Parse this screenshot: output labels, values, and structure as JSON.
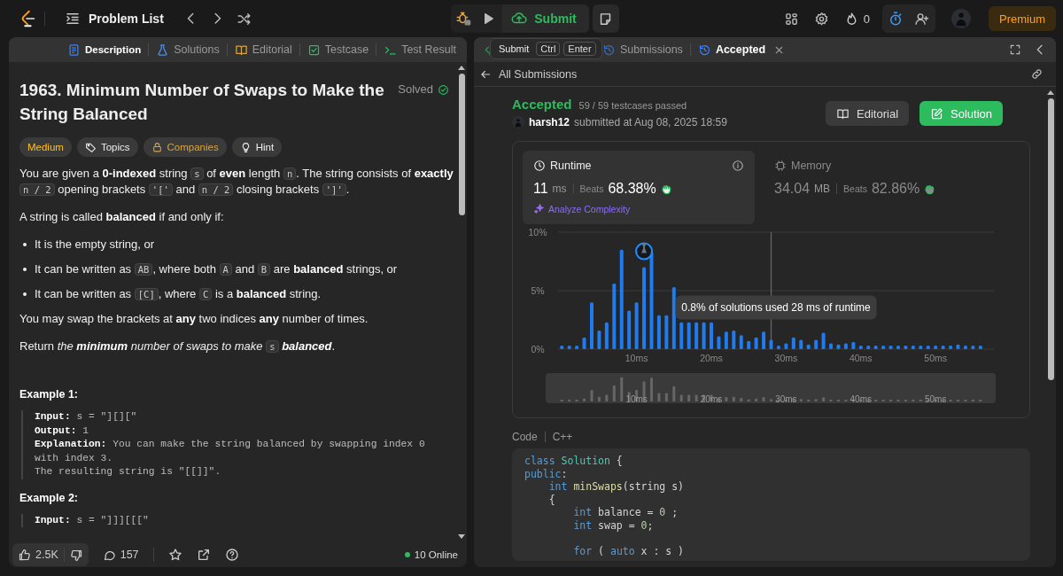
{
  "top_bar": {
    "problem_list": "Problem List",
    "submit": "Submit",
    "streak": "0",
    "premium": "Premium"
  },
  "submit_tooltip": {
    "label": "Submit",
    "keys": [
      "Ctrl",
      "Enter"
    ]
  },
  "problem_panel": {
    "tabs": [
      {
        "label": "Description",
        "kind": "description",
        "selected": true
      },
      {
        "label": "Solutions",
        "kind": "solutions",
        "selected": false
      },
      {
        "label": "Editorial",
        "kind": "editorial",
        "selected": false
      },
      {
        "label": "Testcase",
        "kind": "testcase",
        "selected": false
      },
      {
        "label": "Test Result",
        "kind": "result",
        "selected": false
      }
    ],
    "title": "1963. Minimum Number of Swaps to Make the String Balanced",
    "status": "Solved",
    "tags": [
      {
        "label": "Medium",
        "kind": "difficulty"
      },
      {
        "label": "Topics",
        "kind": "topics"
      },
      {
        "label": "Companies",
        "kind": "companies"
      },
      {
        "label": "Hint",
        "kind": "hint"
      }
    ],
    "body": [
      {
        "kind": "paragraph",
        "segments": [
          {
            "text": "You are given a **0-indexed** string "
          },
          {
            "text": "s",
            "kind": "code"
          },
          {
            "text": " of **even** length "
          },
          {
            "text": "n",
            "kind": "code"
          },
          {
            "text": ". The string consists of **exactly** "
          },
          {
            "text": "n / 2",
            "kind": "code"
          },
          {
            "text": " opening brackets "
          },
          {
            "text": "'['",
            "kind": "code"
          },
          {
            "text": " and "
          },
          {
            "text": "n / 2",
            "kind": "code"
          },
          {
            "text": " closing brackets "
          },
          {
            "text": "']'",
            "kind": "code"
          },
          {
            "text": "."
          }
        ]
      },
      {
        "kind": "paragraph",
        "segments": [
          {
            "text": "A string is called **balanced** if and only if:"
          }
        ]
      },
      {
        "kind": "bullet",
        "segments": [
          {
            "text": "It is the empty string, or"
          }
        ]
      },
      {
        "kind": "bullet",
        "segments": [
          {
            "text": "It can be written as "
          },
          {
            "text": "AB",
            "kind": "code"
          },
          {
            "text": ", where both "
          },
          {
            "text": "A",
            "kind": "code"
          },
          {
            "text": " and "
          },
          {
            "text": "B",
            "kind": "code"
          },
          {
            "text": " are **balanced** strings, or"
          }
        ]
      },
      {
        "kind": "bullet",
        "segments": [
          {
            "text": "It can be written as "
          },
          {
            "text": "[C]",
            "kind": "code"
          },
          {
            "text": ", where "
          },
          {
            "text": "C",
            "kind": "code"
          },
          {
            "text": " is a **balanced** string."
          }
        ]
      },
      {
        "kind": "paragraph",
        "segments": [
          {
            "text": "You may swap the brackets at **any** two indices **any** number of times."
          }
        ]
      },
      {
        "kind": "paragraph",
        "segments": [
          {
            "text": "Return "
          },
          {
            "text": "the **minimum** number of swaps to make ",
            "kind": "emphasis"
          },
          {
            "text": "s",
            "kind": "code"
          },
          {
            "text": " **balanced**",
            "kind": "emphasis"
          },
          {
            "text": "."
          }
        ]
      }
    ],
    "examples": [
      {
        "title": "Example 1:",
        "lines": [
          {
            "label": "Input:",
            "text": " s = \"][][\""
          },
          {
            "label": "Output:",
            "text": " 1"
          },
          {
            "label": "Explanation:",
            "text": " You can make the string balanced by swapping index 0 with index 3."
          },
          {
            "text": "The resulting string is \"[[]]\"."
          }
        ]
      },
      {
        "title": "Example 2:",
        "lines": [
          {
            "label": "Input:",
            "text": " s = \"]]][[[\""
          }
        ]
      }
    ],
    "footer": {
      "likes": "2.5K",
      "comments": "157",
      "online": "10 Online"
    }
  },
  "result_panel": {
    "tabs": [
      {
        "kind": "code",
        "selected": false
      },
      {
        "kind": "submissions",
        "label": "Submissions",
        "selected": false
      },
      {
        "kind": "accepted",
        "label": "Accepted",
        "selected": true
      }
    ],
    "back_link": "All Submissions",
    "result": {
      "status": "Accepted",
      "testcases": "59 / 59 testcases passed",
      "user": "harsh12",
      "submitted": "submitted at Aug 08, 2025 18:59",
      "buttons": [
        {
          "label": "Editorial",
          "kind": "secondary"
        },
        {
          "label": "Solution",
          "kind": "primary"
        }
      ]
    },
    "metrics": [
      {
        "kind": "runtime",
        "label": "Runtime",
        "value": "11",
        "unit": "ms",
        "beats_label": "Beats",
        "beats": "68.38%",
        "selected": true,
        "link": "Analyze Complexity"
      },
      {
        "kind": "memory",
        "label": "Memory",
        "value": "34.04",
        "unit": "MB",
        "beats_label": "Beats",
        "beats": "82.86%",
        "selected": false
      }
    ],
    "chart_data": {
      "type": "bar",
      "x": [
        0,
        1,
        2,
        3,
        4,
        5,
        6,
        7,
        8,
        9,
        10,
        11,
        12,
        13,
        14,
        15,
        16,
        17,
        18,
        19,
        20,
        21,
        22,
        23,
        24,
        25,
        26,
        27,
        28,
        29,
        30,
        31,
        32,
        33,
        34,
        35,
        36,
        37,
        38,
        39,
        40,
        41,
        42,
        43,
        44,
        45,
        46,
        47,
        48,
        49,
        50,
        51,
        52,
        53,
        54,
        55,
        56
      ],
      "xlim": [
        -0.5,
        57.8
      ],
      "series": [
        {
          "color": "#1f7cf0",
          "values": [
            0.3,
            0.3,
            0.3,
            1.0,
            4.0,
            1.6,
            2.3,
            5.6,
            8.5,
            3.3,
            4.0,
            7.0,
            8.3,
            2.9,
            2.9,
            5.3,
            2.3,
            2.3,
            2.3,
            2.3,
            2.3,
            1.1,
            1.5,
            1.6,
            1.2,
            0.7,
            1.0,
            1.5,
            0.8,
            0.3,
            0.5,
            1.0,
            0.8,
            0.4,
            0.8,
            1.4,
            0.5,
            0.4,
            0.5,
            0.6,
            0.3,
            0.3,
            0.3,
            0.3,
            0.3,
            0.3,
            0.3,
            0.3,
            0.3,
            0.3,
            0.3,
            0.3,
            0.3,
            0.4,
            0.3,
            0.3,
            0.3
          ]
        }
      ],
      "ylim": [
        0,
        10
      ],
      "yticks": [
        {
          "value": 0,
          "label": "0%"
        },
        {
          "value": 5,
          "label": "5%"
        },
        {
          "value": 10,
          "label": "10%"
        }
      ],
      "xticks": [
        {
          "value": 10,
          "label": "10ms"
        },
        {
          "value": 20,
          "label": "20ms"
        },
        {
          "value": 30,
          "label": "30ms"
        },
        {
          "value": 40,
          "label": "40ms"
        },
        {
          "value": 50,
          "label": "50ms"
        }
      ],
      "ref_lines": [
        {
          "axis": "x",
          "value": 28
        }
      ],
      "annotations": [
        {
          "x": 28,
          "y": 0.8,
          "text": "0.8% of solutions used 28 ms of runtime"
        }
      ]
    },
    "navigator_ticks": [
      "10ms",
      "20ms",
      "30ms",
      "40ms",
      "50ms"
    ],
    "code": {
      "label": "Code",
      "language": "C++",
      "lines": [
        {
          "segments": [
            {
              "text": "class",
              "kind": "keyword"
            },
            {
              "text": " Solution",
              "kind": "type"
            },
            {
              "text": " {"
            }
          ]
        },
        {
          "segments": [
            {
              "text": "public",
              "kind": "keyword"
            },
            {
              "text": ":"
            }
          ]
        },
        {
          "segments": [
            {
              "text": "    int",
              "kind": "keyword"
            },
            {
              "text": " minSwaps",
              "kind": "function"
            },
            {
              "text": "(string s)"
            }
          ]
        },
        {
          "segments": [
            {
              "text": "    {"
            }
          ]
        },
        {
          "segments": [
            {
              "text": "        int",
              "kind": "keyword"
            },
            {
              "text": " balance = "
            },
            {
              "text": "0",
              "kind": "number"
            },
            {
              "text": " ;"
            }
          ]
        },
        {
          "segments": [
            {
              "text": "        int",
              "kind": "keyword"
            },
            {
              "text": " swap = "
            },
            {
              "text": "0",
              "kind": "number"
            },
            {
              "text": ";"
            }
          ]
        },
        {
          "gap_before": true,
          "segments": [
            {
              "text": "        for",
              "kind": "keyword"
            },
            {
              "text": " ( "
            },
            {
              "text": "auto",
              "kind": "keyword"
            },
            {
              "text": " x : s )"
            }
          ]
        }
      ]
    }
  }
}
